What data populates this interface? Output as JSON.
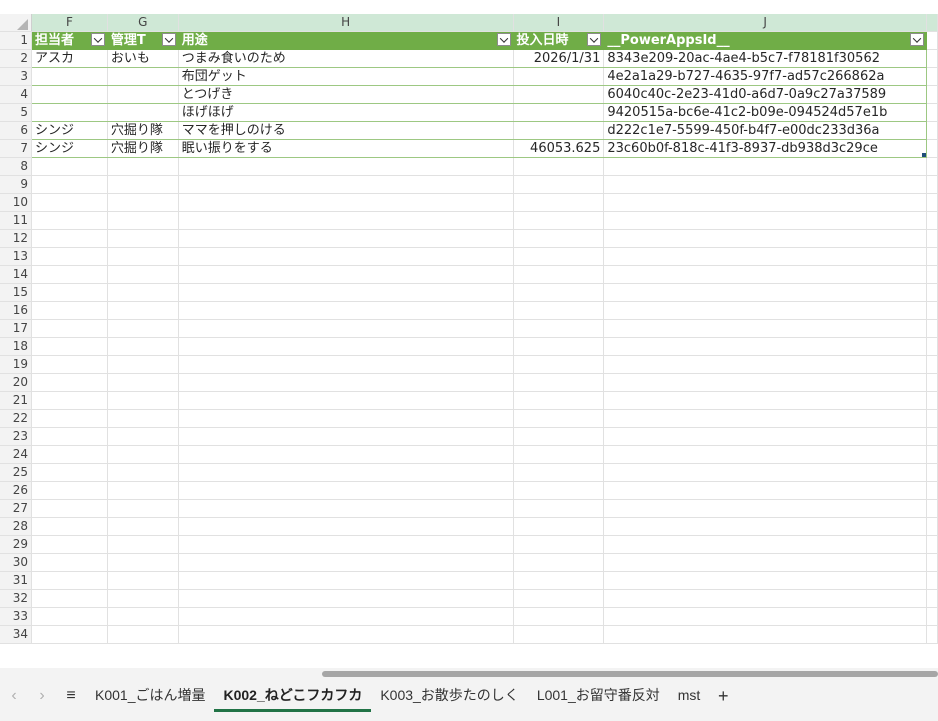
{
  "columns": [
    "F",
    "G",
    "H",
    "I",
    "J"
  ],
  "table_headers": [
    "担当者",
    "管理T",
    "用途",
    "投入日時",
    "__PowerAppsId__"
  ],
  "rows": [
    {
      "num": "2",
      "cells": [
        "アスカ",
        "おいも",
        "つまみ食いのため",
        "2026/1/31",
        "8343e209-20ac-4ae4-b5c7-f78181f30562"
      ]
    },
    {
      "num": "3",
      "cells": [
        "",
        "",
        "布団ゲット",
        "",
        "4e2a1a29-b727-4635-97f7-ad57c266862a"
      ]
    },
    {
      "num": "4",
      "cells": [
        "",
        "",
        "とつげき",
        "",
        "6040c40c-2e23-41d0-a6d7-0a9c27a37589"
      ]
    },
    {
      "num": "5",
      "cells": [
        "",
        "",
        "ほげほげ",
        "",
        "9420515a-bc6e-41c2-b09e-094524d57e1b"
      ]
    },
    {
      "num": "6",
      "cells": [
        "シンジ",
        "穴掘り隊",
        "ママを押しのける",
        "",
        "d222c1e7-5599-450f-b4f7-e00dc233d36a"
      ]
    },
    {
      "num": "7",
      "cells": [
        "シンジ",
        "穴掘り隊",
        "眠い振りをする",
        "46053.625",
        "23c60b0f-818c-41f3-8937-db938d3c29ce"
      ]
    }
  ],
  "empty_rows": [
    "8",
    "9",
    "10",
    "11",
    "12",
    "13",
    "14",
    "15",
    "16",
    "17",
    "18",
    "19",
    "20",
    "21",
    "22",
    "23",
    "24",
    "25",
    "26",
    "27",
    "28",
    "29",
    "30",
    "31",
    "32",
    "33",
    "34"
  ],
  "header_row_num": "1",
  "sheet_tabs": [
    {
      "label": "K001_ごはん増量",
      "active": false
    },
    {
      "label": "K002_ねどこフカフカ",
      "active": true
    },
    {
      "label": "K003_お散歩たのしく",
      "active": false
    },
    {
      "label": "L001_お留守番反対",
      "active": false
    },
    {
      "label": "mst",
      "active": false
    }
  ],
  "nav": {
    "prev": "‹",
    "next": "›",
    "menu": "≡",
    "add": "+"
  },
  "colors": {
    "table_header": "#70ad47",
    "table_border": "#9dc883",
    "col_header_bg": "#cfe8d6",
    "active_tab_underline": "#217346"
  }
}
